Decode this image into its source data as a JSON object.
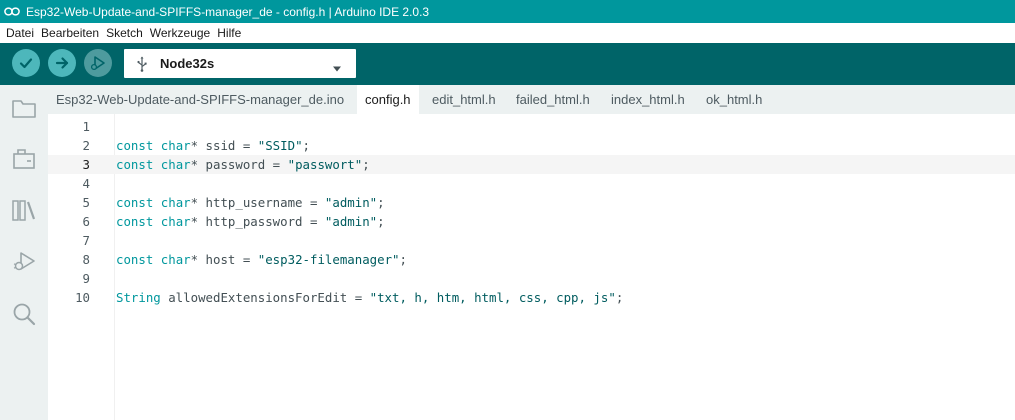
{
  "window": {
    "title": "Esp32-Web-Update-and-SPIFFS-manager_de - config.h | Arduino IDE 2.0.3",
    "logo_icon": "arduino-logo-icon"
  },
  "menu": [
    "Datei",
    "Bearbeiten",
    "Sketch",
    "Werkzeuge",
    "Hilfe"
  ],
  "toolbar": {
    "verify_icon": "check-icon",
    "upload_icon": "arrow-right-icon",
    "debug_icon": "debug-play-icon",
    "board_icon": "usb-icon",
    "board": "Node32s"
  },
  "sidebar": {
    "items": [
      "folder-icon",
      "board-manager-icon",
      "library-icon",
      "debug-icon",
      "search-icon"
    ]
  },
  "tabs": [
    {
      "label": "Esp32-Web-Update-and-SPIFFS-manager_de.ino",
      "active": false
    },
    {
      "label": "config.h",
      "active": true
    },
    {
      "label": "edit_html.h",
      "active": false
    },
    {
      "label": "failed_html.h",
      "active": false
    },
    {
      "label": "index_html.h",
      "active": false
    },
    {
      "label": "ok_html.h",
      "active": false
    }
  ],
  "editor": {
    "current_line": 3,
    "lines": [
      {
        "n": "1",
        "text": ""
      },
      {
        "n": "2",
        "text": "const char* ssid = \"SSID\";"
      },
      {
        "n": "3",
        "text": "const char* password = \"passwort\";"
      },
      {
        "n": "4",
        "text": ""
      },
      {
        "n": "5",
        "text": "const char* http_username = \"admin\";"
      },
      {
        "n": "6",
        "text": "const char* http_password = \"admin\";"
      },
      {
        "n": "7",
        "text": ""
      },
      {
        "n": "8",
        "text": "const char* host = \"esp32-filemanager\";"
      },
      {
        "n": "9",
        "text": ""
      },
      {
        "n": "10",
        "text": "String allowedExtensionsForEdit = \"txt, h, htm, html, css, cpp, js\";"
      }
    ]
  },
  "colors": {
    "title_bar": "#00979d",
    "toolbar": "#006468",
    "button_active": "#4db7bb",
    "button_disabled": "#4e9b9e",
    "sidebar": "#ecf1f1",
    "keyword": "#00979d",
    "string": "#005c5f"
  }
}
